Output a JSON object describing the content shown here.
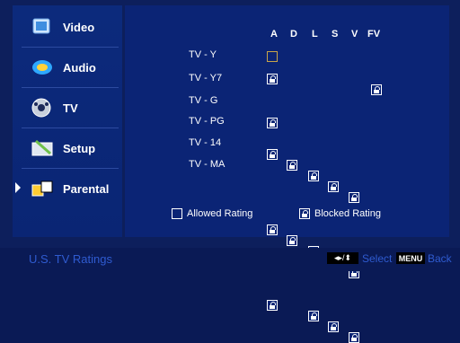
{
  "sidebar": {
    "items": [
      {
        "label": "Video",
        "icon": "video-icon"
      },
      {
        "label": "Audio",
        "icon": "audio-icon"
      },
      {
        "label": "TV",
        "icon": "tv-icon"
      },
      {
        "label": "Setup",
        "icon": "setup-icon"
      },
      {
        "label": "Parental",
        "icon": "parental-icon",
        "selected": true
      }
    ]
  },
  "ratings": {
    "columns": [
      "A",
      "D",
      "L",
      "S",
      "V",
      "FV"
    ],
    "rows": [
      {
        "label": "TV - Y"
      },
      {
        "label": "TV - Y7"
      },
      {
        "label": "TV - G"
      },
      {
        "label": "TV - PG"
      },
      {
        "label": "TV - 14"
      },
      {
        "label": "TV - MA"
      }
    ]
  },
  "legend": {
    "allowed": "Allowed Rating",
    "blocked": "Blocked Rating"
  },
  "footer": {
    "title": "U.S. TV Ratings",
    "select_label": "Select",
    "menu_key": "MENU",
    "back_label": "Back"
  },
  "colors": {
    "background": "#0b2475",
    "footer_text": "#2f5bd0",
    "allowed_border": "#c8a54a"
  }
}
